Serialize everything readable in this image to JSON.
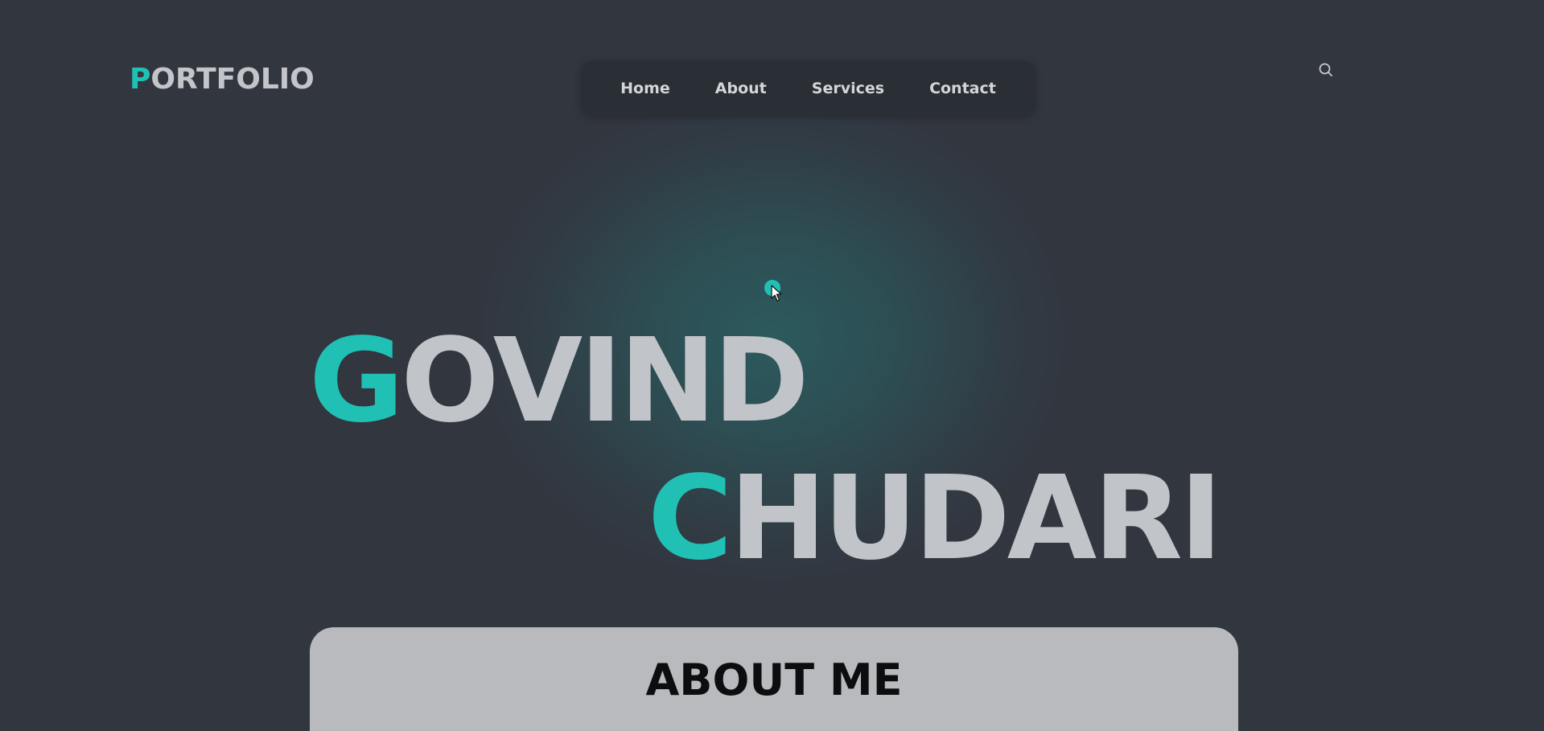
{
  "brand": {
    "initial": "P",
    "rest": "ORTFOLIO"
  },
  "nav": {
    "items": [
      {
        "label": "Home"
      },
      {
        "label": "About"
      },
      {
        "label": "Services"
      },
      {
        "label": "Contact"
      }
    ]
  },
  "icons": {
    "search": "search-icon",
    "cursor": "cursor-arrow-icon"
  },
  "hero": {
    "first_initial": "G",
    "first_rest": "OVIND",
    "last_initial": "C",
    "last_rest": "HUDARI"
  },
  "about": {
    "title": "ABOUT ME"
  },
  "colors": {
    "background": "#32363f",
    "accent": "#20c1b4",
    "text_light": "#c1c4c8",
    "nav_background": "#2a2e35",
    "card_background": "#b9babd"
  }
}
